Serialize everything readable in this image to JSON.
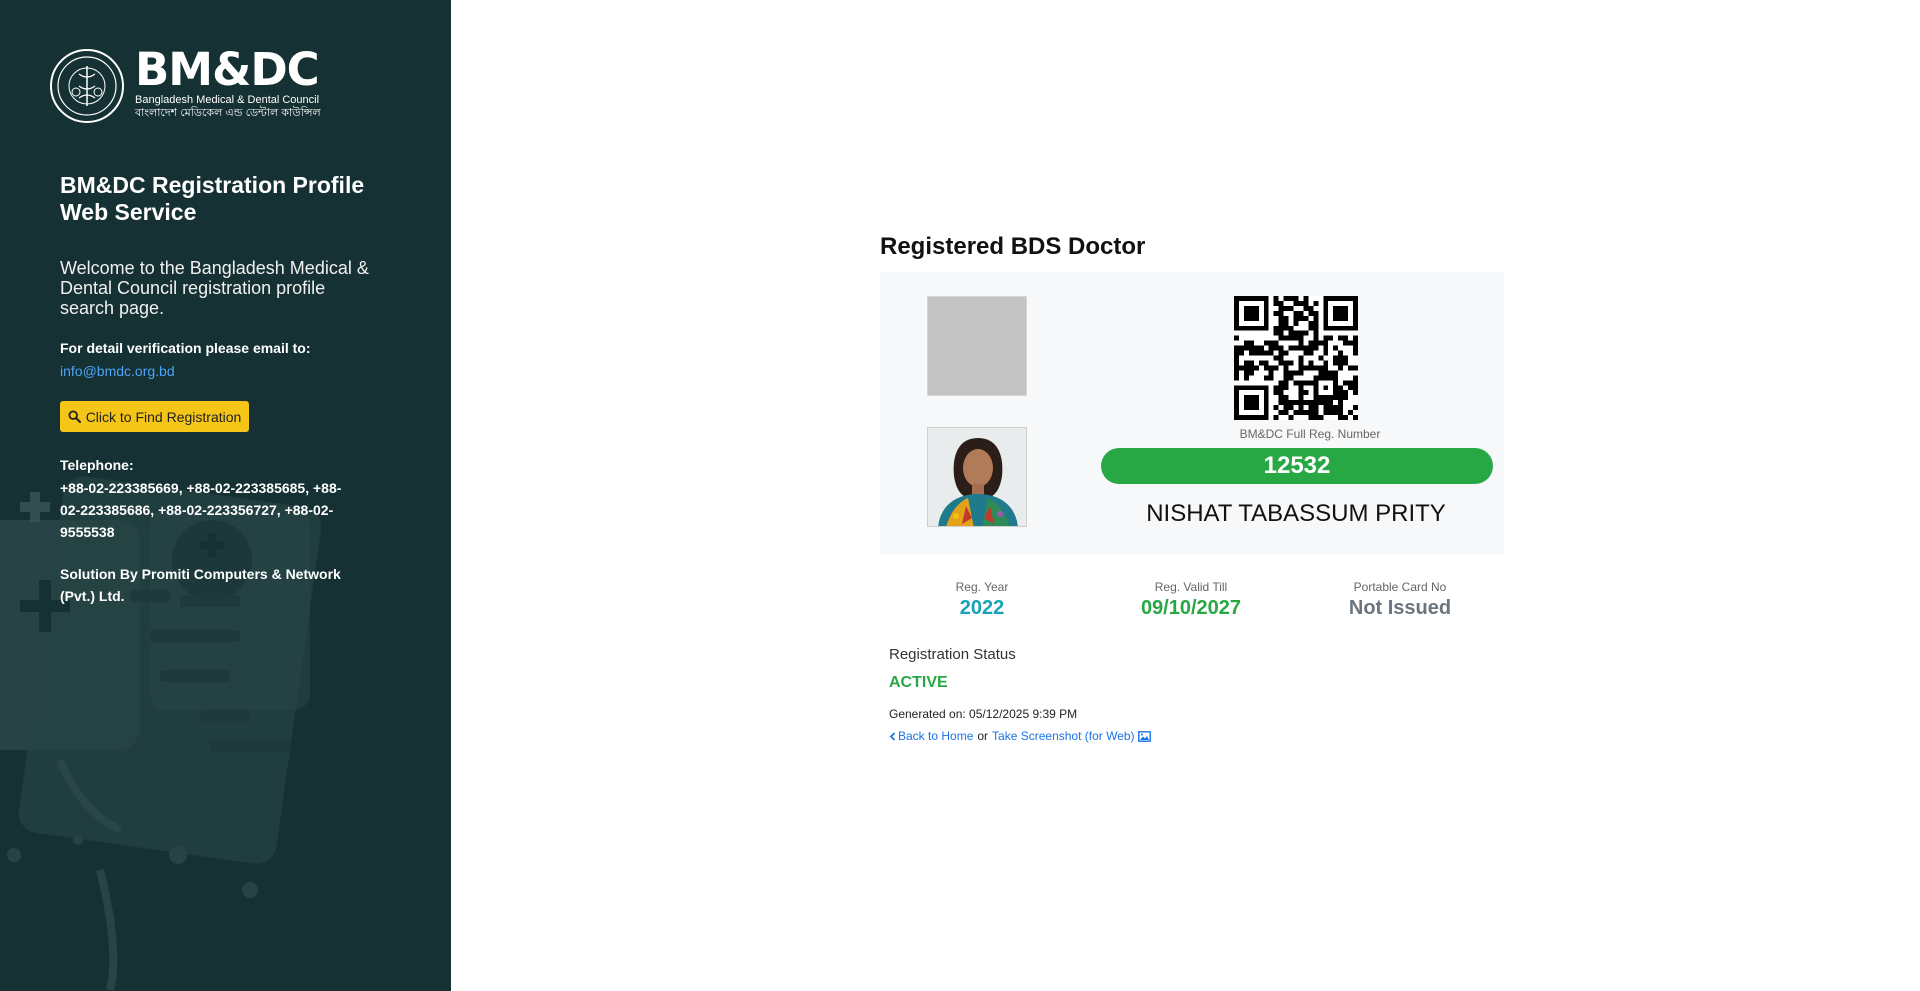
{
  "sidebar": {
    "logo": {
      "title": "BM&DC",
      "subtitle_en": "Bangladesh Medical & Dental Council",
      "subtitle_bn": "বাংলাদেশ মেডিকেল এন্ড ডেন্টাল কাউন্সিল"
    },
    "title": "BM&DC Registration Profile Web Service",
    "welcome": "Welcome to the Bangladesh Medical & Dental Council registration profile search page.",
    "verify_label": "For detail verification please email to:",
    "email": "info@bmdc.org.bd",
    "find_button_label": "Click to Find Registration",
    "telephone_label": "Telephone:",
    "telephone_numbers": "+88-02-223385669, +88-02-223385685, +88-02-223385686, +88-02-223356727, +88-02-9555538",
    "solution": "Solution By Promiti Computers & Network (Pvt.) Ltd."
  },
  "main": {
    "title": "Registered BDS Doctor",
    "card": {
      "reg_number_label": "BM&DC Full Reg. Number",
      "reg_number": "12532",
      "doctor_name": "NISHAT TABASSUM PRITY"
    },
    "stats": [
      {
        "label": "Reg. Year",
        "value": "2022"
      },
      {
        "label": "Reg. Valid Till",
        "value": "09/10/2027"
      },
      {
        "label": "Portable Card No",
        "value": "Not Issued"
      }
    ],
    "status_label": "Registration Status",
    "status_value": "ACTIVE",
    "generated": "Generated on: 05/12/2025 9:39 PM",
    "links": {
      "back_home": "Back to Home",
      "separator": "or",
      "screenshot": "Take Screenshot (for Web)"
    }
  },
  "colors": {
    "sidebar_bg": "#163133",
    "accent_yellow": "#f5c518",
    "success_green": "#28a745",
    "info_teal": "#17a2b8",
    "link_blue": "#1a73e8"
  },
  "icons": {
    "find_button": "search-icon",
    "back_link": "chevron-left-icon",
    "screenshot_link": "image-icon"
  }
}
